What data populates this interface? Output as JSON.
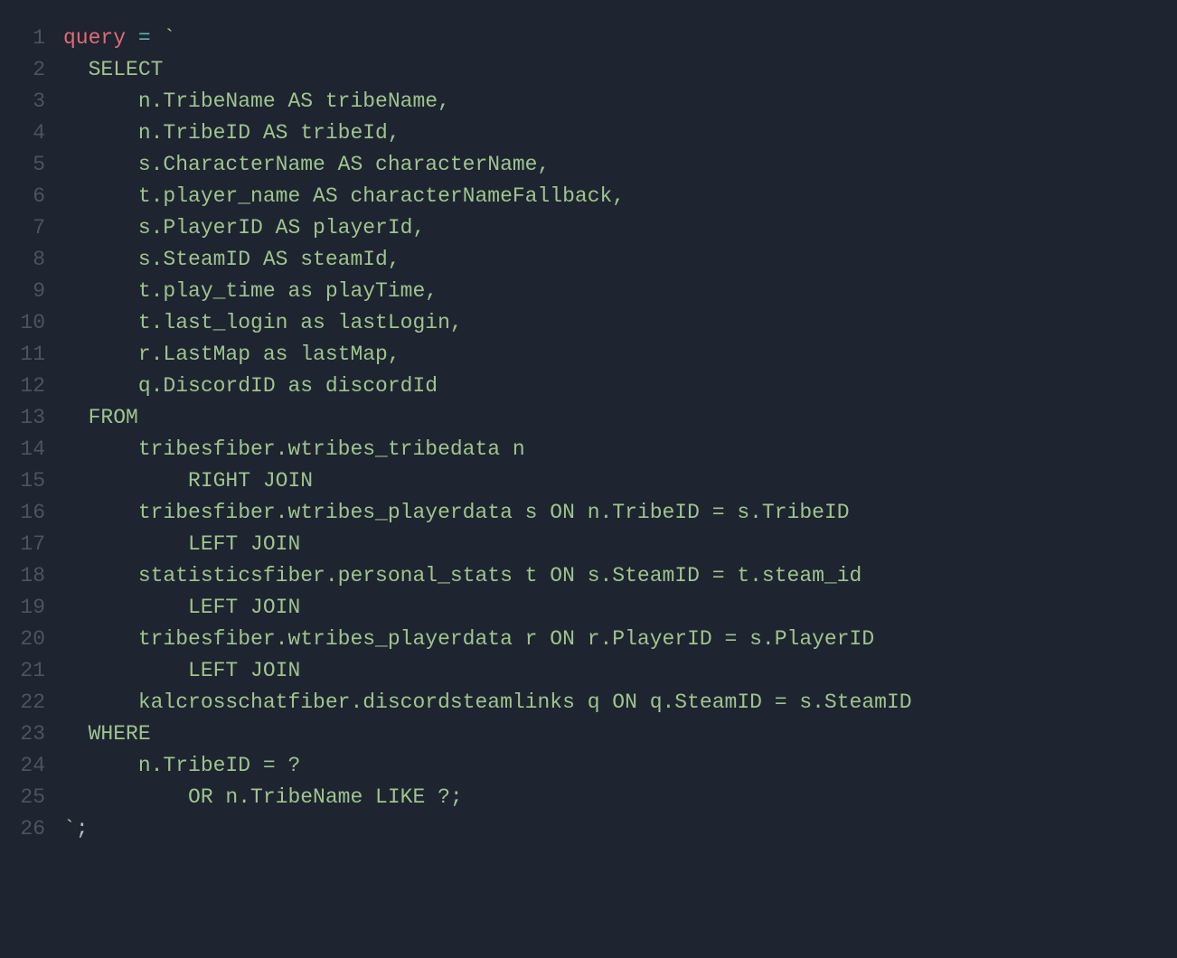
{
  "gutter": {
    "lines": [
      "1",
      "2",
      "3",
      "4",
      "5",
      "6",
      "7",
      "8",
      "9",
      "10",
      "11",
      "12",
      "13",
      "14",
      "15",
      "16",
      "17",
      "18",
      "19",
      "20",
      "21",
      "22",
      "23",
      "24",
      "25",
      "26"
    ]
  },
  "code": {
    "lines": [
      [
        {
          "cls": "tok-var",
          "text": "query"
        },
        {
          "cls": "tok-default",
          "text": " "
        },
        {
          "cls": "tok-op",
          "text": "="
        },
        {
          "cls": "tok-default",
          "text": " "
        },
        {
          "cls": "tok-str",
          "text": "`"
        }
      ],
      [
        {
          "cls": "tok-str",
          "text": "  SELECT"
        }
      ],
      [
        {
          "cls": "tok-str",
          "text": "      n.TribeName AS tribeName,"
        }
      ],
      [
        {
          "cls": "tok-str",
          "text": "      n.TribeID AS tribeId,"
        }
      ],
      [
        {
          "cls": "tok-str",
          "text": "      s.CharacterName AS characterName,"
        }
      ],
      [
        {
          "cls": "tok-str",
          "text": "      t.player_name AS characterNameFallback,"
        }
      ],
      [
        {
          "cls": "tok-str",
          "text": "      s.PlayerID AS playerId,"
        }
      ],
      [
        {
          "cls": "tok-str",
          "text": "      s.SteamID AS steamId,"
        }
      ],
      [
        {
          "cls": "tok-str",
          "text": "      t.play_time as playTime,"
        }
      ],
      [
        {
          "cls": "tok-str",
          "text": "      t.last_login as lastLogin,"
        }
      ],
      [
        {
          "cls": "tok-str",
          "text": "      r.LastMap as lastMap,"
        }
      ],
      [
        {
          "cls": "tok-str",
          "text": "      q.DiscordID as discordId"
        }
      ],
      [
        {
          "cls": "tok-str",
          "text": "  FROM"
        }
      ],
      [
        {
          "cls": "tok-str",
          "text": "      tribesfiber.wtribes_tribedata n"
        }
      ],
      [
        {
          "cls": "tok-str",
          "text": "          RIGHT JOIN"
        }
      ],
      [
        {
          "cls": "tok-str",
          "text": "      tribesfiber.wtribes_playerdata s ON n.TribeID = s.TribeID"
        }
      ],
      [
        {
          "cls": "tok-str",
          "text": "          LEFT JOIN"
        }
      ],
      [
        {
          "cls": "tok-str",
          "text": "      statisticsfiber.personal_stats t ON s.SteamID = t.steam_id"
        }
      ],
      [
        {
          "cls": "tok-str",
          "text": "          LEFT JOIN"
        }
      ],
      [
        {
          "cls": "tok-str",
          "text": "      tribesfiber.wtribes_playerdata r ON r.PlayerID = s.PlayerID"
        }
      ],
      [
        {
          "cls": "tok-str",
          "text": "          LEFT JOIN"
        }
      ],
      [
        {
          "cls": "tok-str",
          "text": "      kalcrosschatfiber.discordsteamlinks q ON q.SteamID = s.SteamID"
        }
      ],
      [
        {
          "cls": "tok-str",
          "text": "  WHERE"
        }
      ],
      [
        {
          "cls": "tok-str",
          "text": "      n.TribeID = ?"
        }
      ],
      [
        {
          "cls": "tok-str",
          "text": "          OR n.TribeName LIKE ?;"
        }
      ],
      [
        {
          "cls": "tok-str",
          "text": "`"
        },
        {
          "cls": "tok-default",
          "text": ";"
        }
      ]
    ]
  }
}
